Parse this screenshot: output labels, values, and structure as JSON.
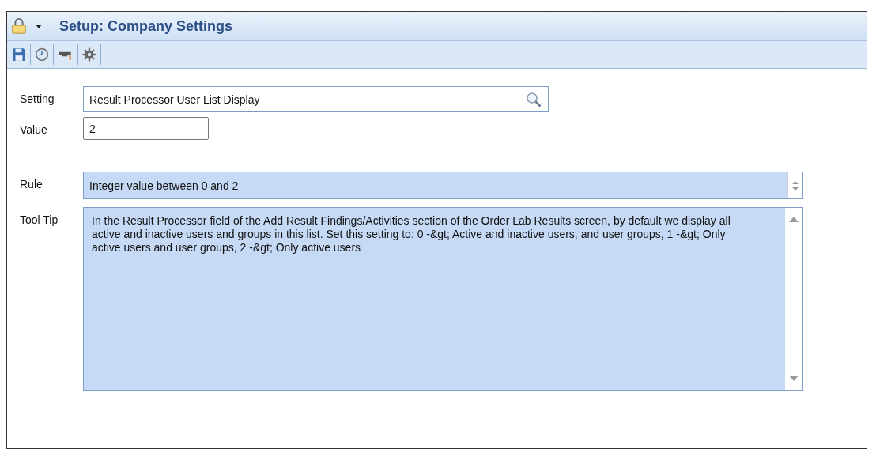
{
  "window": {
    "title": "Setup: Company Settings"
  },
  "fields": [
    {
      "kind": "search",
      "label": "Setting",
      "value": "Result Processor User List Display"
    },
    {
      "kind": "text",
      "label": "Value",
      "value": "2"
    },
    {
      "kind": "spin",
      "label": "Rule",
      "value": "Integer value between 0 and 2"
    },
    {
      "kind": "memo",
      "label": "Tool Tip",
      "value": "In the Result Processor field of the Add Result Findings/Activities section of the Order Lab Results screen, by default we display all active and inactive users and groups in this list. Set this setting to: 0 -&gt; Active and inactive users, and user groups, 1 -&gt; Only active users and user groups, 2 -&gt; Only active users"
    }
  ]
}
